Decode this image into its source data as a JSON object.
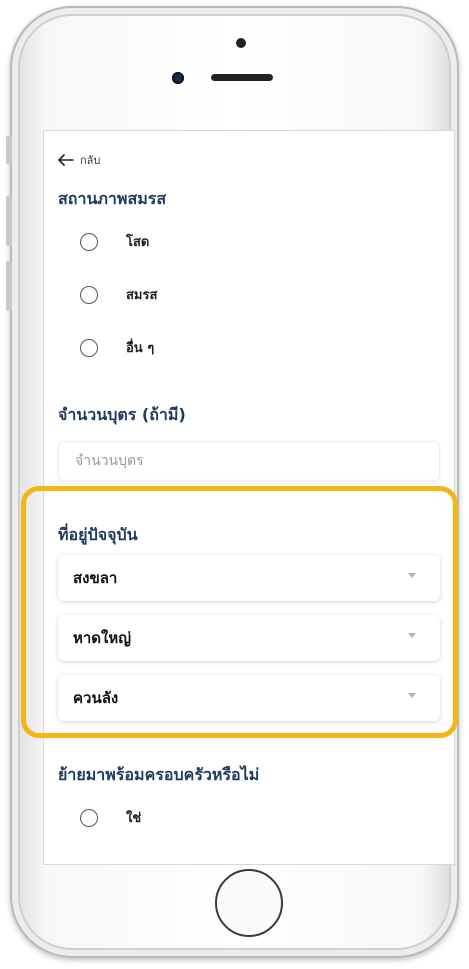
{
  "nav": {
    "back_label": "กลับ"
  },
  "marital": {
    "title": "สถานภาพสมรส",
    "options": [
      "โสด",
      "สมรส",
      "อื่น ๆ"
    ]
  },
  "children": {
    "title": "จำนวนบุตร (ถ้ามี)",
    "placeholder": "จำนวนบุตร",
    "value": ""
  },
  "address": {
    "title": "ที่อยู่ปัจจุบัน",
    "province": "สงขลา",
    "district": "หาดใหญ่",
    "subdistrict": "ควนลัง"
  },
  "relocation": {
    "title": "ย้ายมาพร้อมครอบครัวหรือไม่",
    "options": [
      "ใช่"
    ]
  },
  "colors": {
    "heading": "#1f3b5f",
    "highlight": "#f5b516"
  }
}
